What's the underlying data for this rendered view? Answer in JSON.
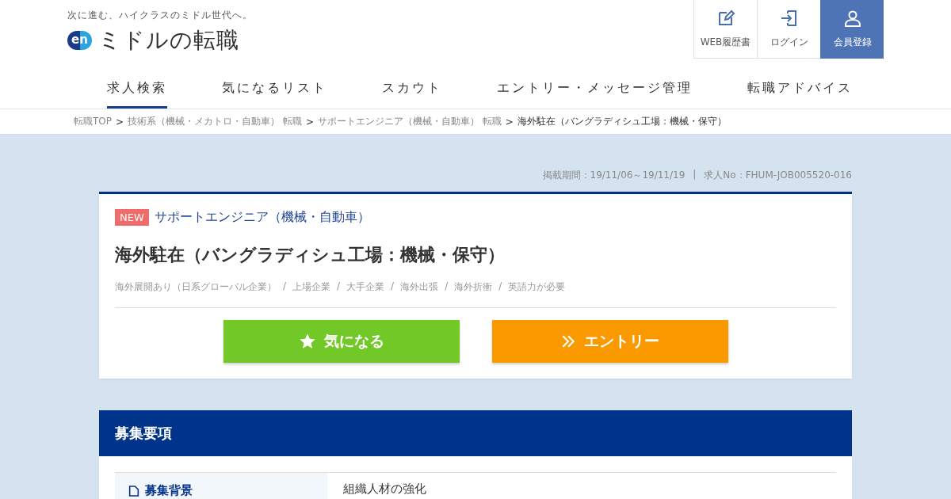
{
  "header": {
    "tagline": "次に進む、ハイクラスのミドル世代へ。",
    "logo": {
      "mark": "en",
      "name": "ミドルの転職"
    }
  },
  "account_links": [
    {
      "label": "WEB履歴書",
      "kind": "resume",
      "highlighted": false
    },
    {
      "label": "ログイン",
      "kind": "login",
      "highlighted": false
    },
    {
      "label": "会員登録",
      "kind": "register",
      "highlighted": true
    }
  ],
  "nav": [
    {
      "label": "求人検索",
      "selected": true
    },
    {
      "label": "気になるリスト",
      "selected": false
    },
    {
      "label": "スカウト",
      "selected": false
    },
    {
      "label": "エントリー・メッセージ管理",
      "selected": false
    },
    {
      "label": "転職アドバイス",
      "selected": false
    }
  ],
  "breadcrumb": [
    {
      "label": "転職TOP",
      "current": false
    },
    {
      "separator": ">",
      "label": "技術系（機械・メカトロ・自動車） 転職",
      "current": false
    },
    {
      "separator": ">",
      "label": "サポートエンジニア（機械・自動車） 転職",
      "current": false
    },
    {
      "separator": ">",
      "label": "海外駐在（バングラディシュ工場：機械・保守）",
      "current": true
    }
  ],
  "meta": {
    "period": "掲載期間：19/11/06～19/11/19",
    "divider": "|",
    "job_no": "求人No：FHUM-JOB005520-016"
  },
  "job": {
    "badge": "NEW",
    "category": "サポートエンジニア（機械・自動車）",
    "title": "海外駐在（バングラディシュ工場：機械・保守）",
    "tags": [
      {
        "label": "海外展開あり（日系グローバル企業）"
      },
      {
        "separator": "/",
        "label": "上場企業"
      },
      {
        "separator": "/",
        "label": "大手企業"
      },
      {
        "separator": "/",
        "label": "海外出張"
      },
      {
        "separator": "/",
        "label": "海外折衝"
      },
      {
        "separator": "/",
        "label": "英語力が必要"
      }
    ],
    "actions": [
      {
        "label": "気になる",
        "kind": "favorite"
      },
      {
        "label": "エントリー",
        "kind": "entry"
      }
    ]
  },
  "section": {
    "title": "募集要項",
    "rows": [
      {
        "label": "募集背景",
        "value": "組織人材の強化"
      }
    ]
  }
}
